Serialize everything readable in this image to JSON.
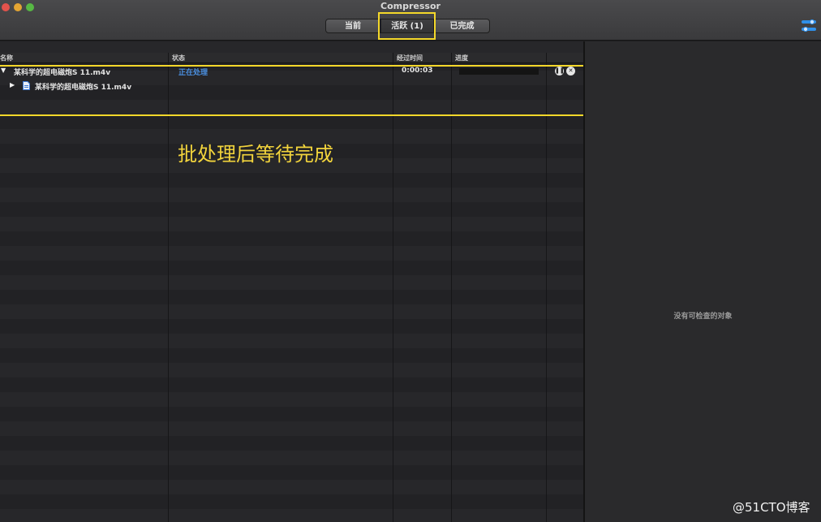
{
  "window": {
    "title": "Compressor"
  },
  "toolbar": {
    "tabs": [
      {
        "label": "当前"
      },
      {
        "label": "活跃 (1)",
        "selected": true
      },
      {
        "label": "已完成"
      }
    ],
    "settings_icon": "sliders-icon"
  },
  "list": {
    "columns": {
      "name": "名称",
      "status": "状态",
      "elapsed": "经过时间",
      "progress": "进度"
    },
    "batch": {
      "name": "某科学的超电磁炮S 11.m4v",
      "status": "正在处理",
      "elapsed": "0:00:03",
      "progress_fraction": 0.0
    },
    "job": {
      "name": "某科学的超电磁炮S 11.m4v"
    }
  },
  "annotation": {
    "text": "批处理后等待完成"
  },
  "inspector": {
    "empty_text": "没有可检查的对象"
  },
  "watermark": {
    "text": "@51CTO博客"
  },
  "colors": {
    "highlight": "#f4d82a",
    "status_blue": "#4a8fe0"
  }
}
